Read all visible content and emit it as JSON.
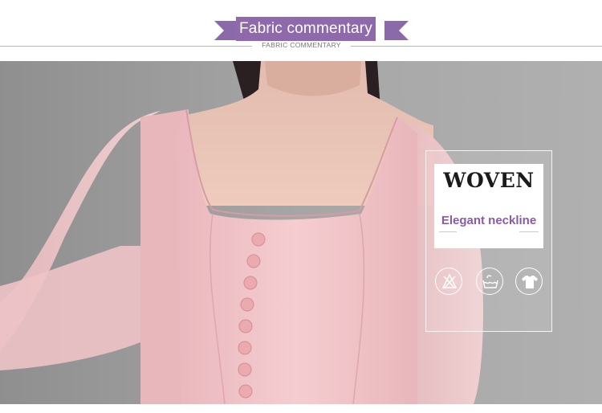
{
  "header": {
    "title": "Fabric commentary",
    "subtitle": "FABRIC COMMENTARY",
    "ribbon_color": "#8e6aad"
  },
  "panel": {
    "title": "WOVEN",
    "subtitle": "Elegant neckline",
    "subtitle_color": "#8a5aa6",
    "icons": [
      "no-bleach-icon",
      "hand-wash-icon",
      "t-shirt-icon"
    ]
  }
}
